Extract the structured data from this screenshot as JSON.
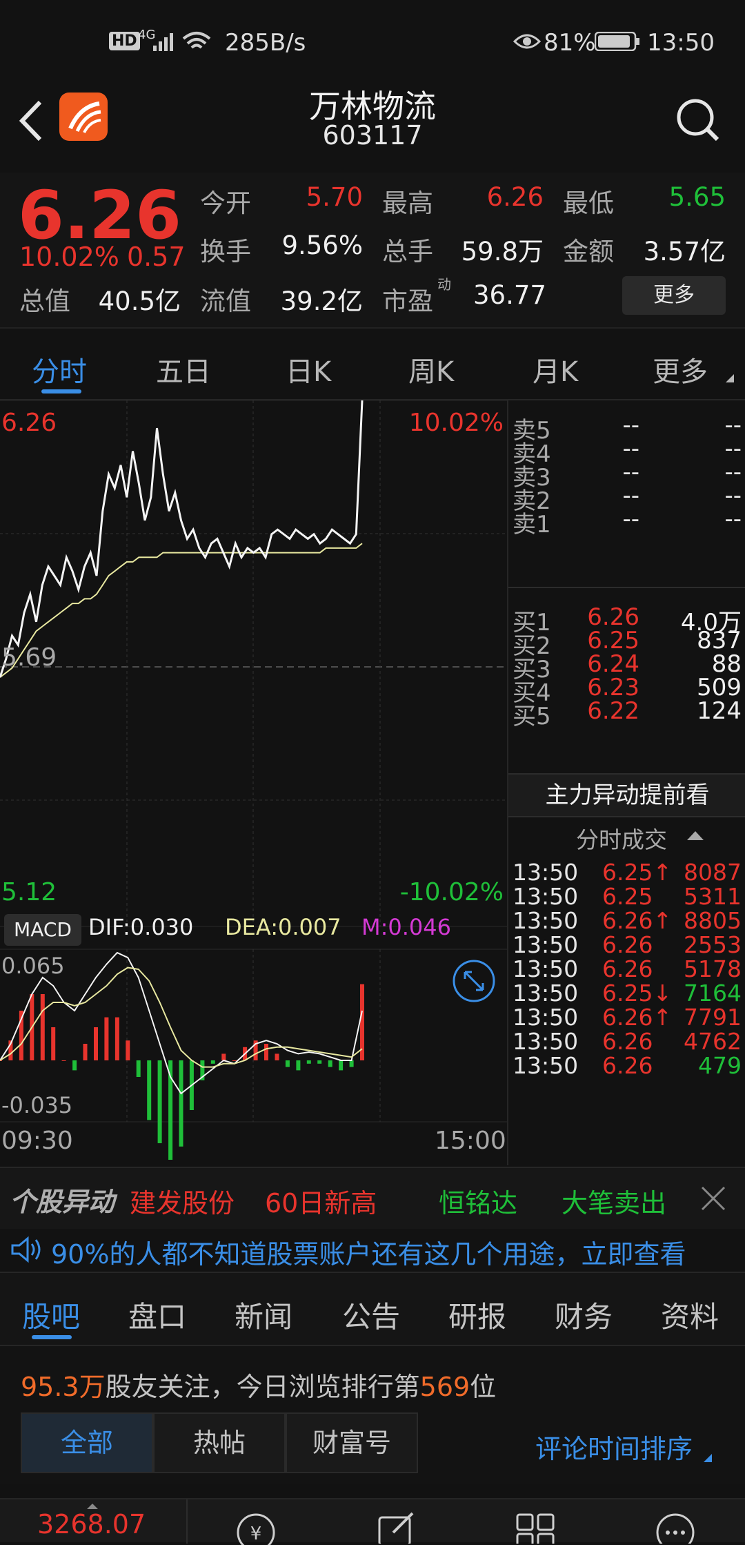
{
  "status": {
    "network": "285B/s",
    "battery": "81%",
    "time": "13:50",
    "hd": "HD",
    "net_type": "4G"
  },
  "header": {
    "name": "万林物流",
    "code": "603117"
  },
  "quote": {
    "price": "6.26",
    "change_pct": "10.02%",
    "change": "0.57",
    "total_value_label": "总值",
    "total_value": "40.5亿",
    "open_label": "今开",
    "open": "5.70",
    "high_label": "最高",
    "high": "6.26",
    "low_label": "最低",
    "low": "5.65",
    "turnover_label": "换手",
    "turnover": "9.56%",
    "volume_label": "总手",
    "volume": "59.8万",
    "amount_label": "金额",
    "amount": "3.57亿",
    "float_value_label": "流值",
    "float_value": "39.2亿",
    "pe_label": "市盈",
    "pe_sup": "动",
    "pe": "36.77",
    "more_button": "更多"
  },
  "tabs": [
    "分时",
    "五日",
    "日K",
    "周K",
    "月K",
    "更多"
  ],
  "chart": {
    "top_price": "6.26",
    "top_pct": "10.02%",
    "mid_price": "5.69",
    "bottom_price": "5.12",
    "bottom_pct": "-10.02%",
    "macd_label": "MACD",
    "dif": "DIF:0.030",
    "dea": "DEA:0.007",
    "m": "M:0.046",
    "macd_top": "0.065",
    "macd_bottom": "-0.035",
    "time_start": "09:30",
    "time_end": "15:00"
  },
  "chart_data": {
    "type": "line",
    "ylim": [
      5.12,
      6.26
    ],
    "x_range": [
      "09:30",
      "15:00"
    ],
    "series": [],
    "price_line": [
      5.66,
      5.7,
      5.75,
      5.73,
      5.8,
      5.84,
      5.78,
      5.86,
      5.9,
      5.88,
      5.86,
      5.92,
      5.89,
      5.85,
      5.9,
      5.93,
      5.88,
      6.02,
      6.1,
      6.07,
      6.12,
      6.05,
      6.15,
      6.08,
      6.0,
      6.05,
      6.2,
      6.1,
      6.02,
      6.06,
      6.0,
      5.96,
      5.98,
      5.94,
      5.92,
      5.95,
      5.96,
      5.93,
      5.9,
      5.95,
      5.92,
      5.94,
      5.93,
      5.94,
      5.92,
      5.97,
      5.98,
      5.97,
      5.96,
      5.98,
      5.97,
      5.96,
      5.97,
      5.95,
      5.96,
      5.98,
      5.97,
      5.96,
      5.95,
      5.97,
      6.26
    ],
    "avg_line": [
      5.66,
      5.67,
      5.68,
      5.7,
      5.72,
      5.74,
      5.76,
      5.77,
      5.78,
      5.79,
      5.8,
      5.81,
      5.82,
      5.82,
      5.83,
      5.83,
      5.84,
      5.86,
      5.88,
      5.89,
      5.9,
      5.91,
      5.91,
      5.92,
      5.92,
      5.92,
      5.92,
      5.93,
      5.93,
      5.93,
      5.93,
      5.93,
      5.93,
      5.93,
      5.93,
      5.93,
      5.93,
      5.93,
      5.93,
      5.93,
      5.93,
      5.93,
      5.93,
      5.93,
      5.93,
      5.93,
      5.93,
      5.93,
      5.93,
      5.93,
      5.93,
      5.93,
      5.93,
      5.93,
      5.94,
      5.94,
      5.94,
      5.94,
      5.94,
      5.94,
      5.95
    ],
    "macd_dif": [
      0.0,
      0.01,
      0.025,
      0.04,
      0.05,
      0.045,
      0.035,
      0.03,
      0.04,
      0.05,
      0.058,
      0.065,
      0.062,
      0.05,
      0.03,
      0.01,
      -0.01,
      -0.02,
      -0.015,
      -0.01,
      -0.005,
      0.0,
      -0.002,
      0.004,
      0.01,
      0.012,
      0.01,
      0.006,
      0.004,
      0.005,
      0.004,
      0.002,
      0.0,
      0.0,
      0.03
    ],
    "macd_dea": [
      0.0,
      0.004,
      0.01,
      0.02,
      0.03,
      0.035,
      0.035,
      0.033,
      0.035,
      0.04,
      0.045,
      0.052,
      0.056,
      0.055,
      0.048,
      0.035,
      0.02,
      0.006,
      0.0,
      -0.004,
      -0.004,
      -0.002,
      -0.002,
      0.0,
      0.004,
      0.007,
      0.008,
      0.008,
      0.007,
      0.006,
      0.005,
      0.004,
      0.003,
      0.002,
      0.007
    ],
    "macd_hist": [
      0.0,
      0.012,
      0.03,
      0.04,
      0.04,
      0.02,
      0.0,
      -0.006,
      0.01,
      0.02,
      0.026,
      0.026,
      0.012,
      -0.01,
      -0.036,
      -0.05,
      -0.06,
      -0.052,
      -0.03,
      -0.012,
      -0.002,
      0.004,
      0.0,
      0.008,
      0.012,
      0.01,
      0.004,
      -0.004,
      -0.006,
      -0.002,
      -0.002,
      -0.004,
      -0.006,
      -0.004,
      0.046
    ]
  },
  "orderbook": {
    "asks": [
      {
        "label": "卖5",
        "price": "--",
        "vol": "--"
      },
      {
        "label": "卖4",
        "price": "--",
        "vol": "--"
      },
      {
        "label": "卖3",
        "price": "--",
        "vol": "--"
      },
      {
        "label": "卖2",
        "price": "--",
        "vol": "--"
      },
      {
        "label": "卖1",
        "price": "--",
        "vol": "--"
      }
    ],
    "bids": [
      {
        "label": "买1",
        "price": "6.26",
        "vol": "4.0万"
      },
      {
        "label": "买2",
        "price": "6.25",
        "vol": "837"
      },
      {
        "label": "买3",
        "price": "6.24",
        "vol": "88"
      },
      {
        "label": "买4",
        "price": "6.23",
        "vol": "509"
      },
      {
        "label": "买5",
        "price": "6.22",
        "vol": "124"
      }
    ],
    "promo": "主力异动提前看",
    "trades_title": "分时成交",
    "trades": [
      {
        "time": "13:50",
        "price": "6.25",
        "arrow": "↑",
        "vol": "8087",
        "side": "buy"
      },
      {
        "time": "13:50",
        "price": "6.25",
        "arrow": "",
        "vol": "5311",
        "side": "buy"
      },
      {
        "time": "13:50",
        "price": "6.26",
        "arrow": "↑",
        "vol": "8805",
        "side": "buy"
      },
      {
        "time": "13:50",
        "price": "6.26",
        "arrow": "",
        "vol": "2553",
        "side": "buy"
      },
      {
        "time": "13:50",
        "price": "6.26",
        "arrow": "",
        "vol": "5178",
        "side": "buy"
      },
      {
        "time": "13:50",
        "price": "6.25",
        "arrow": "↓",
        "vol": "7164",
        "side": "sell"
      },
      {
        "time": "13:50",
        "price": "6.26",
        "arrow": "↑",
        "vol": "7791",
        "side": "buy"
      },
      {
        "time": "13:50",
        "price": "6.26",
        "arrow": "",
        "vol": "4762",
        "side": "buy"
      },
      {
        "time": "13:50",
        "price": "6.26",
        "arrow": "",
        "vol": "479",
        "side": "sell"
      }
    ]
  },
  "alert": {
    "logo": "个股异动",
    "stock1": "建发股份",
    "event1": "60日新高",
    "stock2": "恒铭达",
    "event2": "大笔卖出"
  },
  "notice": {
    "text": "90%的人都不知道股票账户还有这几个用途，立即查看"
  },
  "bottom_tabs": [
    "股吧",
    "盘口",
    "新闻",
    "公告",
    "研报",
    "财务",
    "资料"
  ],
  "forum": {
    "followers": "95.3万",
    "followers_text": "股友关注，今日浏览排行第",
    "rank": "569",
    "rank_suffix": "位",
    "filters": [
      "全部",
      "热帖",
      "财富号"
    ],
    "sort": "评论时间排序"
  },
  "navbar": {
    "index_value": "3268.07"
  },
  "colors": {
    "up": "#e8342d",
    "down": "#1fbf39",
    "accent": "#3a8ee6",
    "avg_line": "#e8e8a0"
  }
}
